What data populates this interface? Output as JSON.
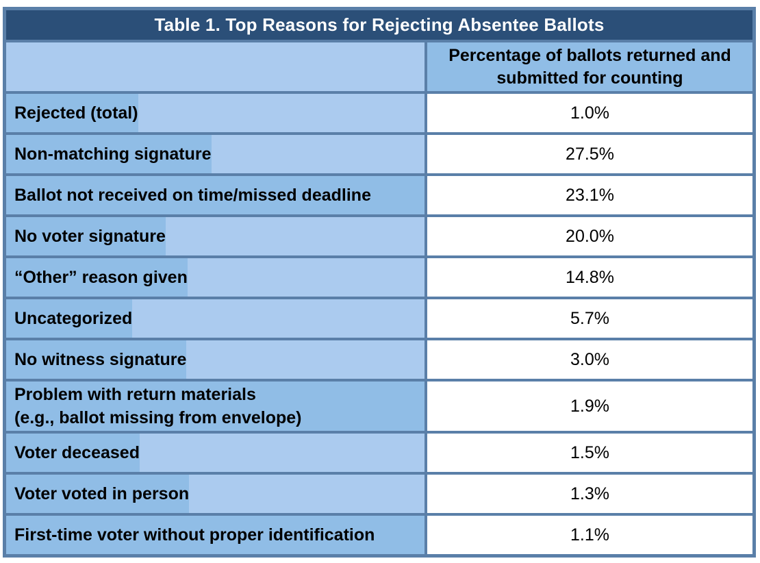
{
  "table": {
    "title": "Table 1. Top Reasons for Rejecting Absentee Ballots",
    "header": {
      "label_column": "",
      "value_column": "Percentage of ballots returned and submitted for counting",
      "value_column_line1": "Percentage of ballots returned and",
      "value_column_line2": "submitted for counting"
    },
    "rows": [
      {
        "label": "Rejected (total)",
        "value": "1.0%"
      },
      {
        "label": "Non-matching signature",
        "value": "27.5%"
      },
      {
        "label": "Ballot not received on time/missed deadline",
        "value": "23.1%"
      },
      {
        "label": "No voter signature",
        "value": "20.0%"
      },
      {
        "label": "“Other” reason given",
        "value": "14.8%"
      },
      {
        "label": "Uncategorized",
        "value": "5.7%"
      },
      {
        "label": "No witness signature",
        "value": "3.0%"
      },
      {
        "label": "Problem with return materials (e.g., ballot missing from envelope)",
        "label_line1": "Problem with return materials",
        "label_line2": "(e.g., ballot missing from envelope)",
        "value": "1.9%"
      },
      {
        "label": "Voter deceased",
        "value": "1.5%"
      },
      {
        "label": "Voter voted in person",
        "value": "1.3%"
      },
      {
        "label": "First-time voter without proper identification",
        "value": "1.1%"
      }
    ]
  },
  "colors": {
    "title_bar": "#2b4f78",
    "border": "#5a7fa8",
    "label_highlight": "#90bde6",
    "label_background": "#abcbef",
    "value_background": "#ffffff"
  }
}
